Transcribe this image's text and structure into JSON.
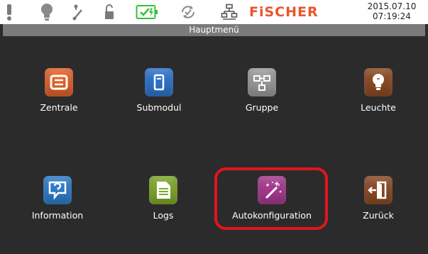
{
  "status_bar": {
    "icons": [
      "exclamation-icon",
      "bulb-icon",
      "switch-icon",
      "unlock-icon",
      "battery-charging-icon",
      "sync-check-icon",
      "network-icon"
    ],
    "brand": "FiSCHER",
    "date": "2015.07.10",
    "time": "07:19:24"
  },
  "header": {
    "title": "Hauptmenü"
  },
  "menu": {
    "items": [
      {
        "label": "Zentrale",
        "icon": "central-unit-icon",
        "color": "#e0622a"
      },
      {
        "label": "Submodul",
        "icon": "submodule-icon",
        "color": "#2f73c9"
      },
      {
        "label": "Gruppe",
        "icon": "group-icon",
        "color": "#9a9a9a"
      },
      {
        "label": "Leuchte",
        "icon": "lamp-icon",
        "color": "#8a4a25"
      },
      {
        "label": "Information",
        "icon": "help-question-icon",
        "color": "#2f7cc9"
      },
      {
        "label": "Logs",
        "icon": "document-icon",
        "color": "#7fa72a"
      },
      {
        "label": "Autokonfiguration",
        "icon": "magic-wand-icon",
        "color": "#a53a8e"
      },
      {
        "label": "Zurück",
        "icon": "exit-door-icon",
        "color": "#8a4a25"
      }
    ],
    "highlighted": "Autokonfiguration",
    "highlight_color": "#e3141b"
  }
}
